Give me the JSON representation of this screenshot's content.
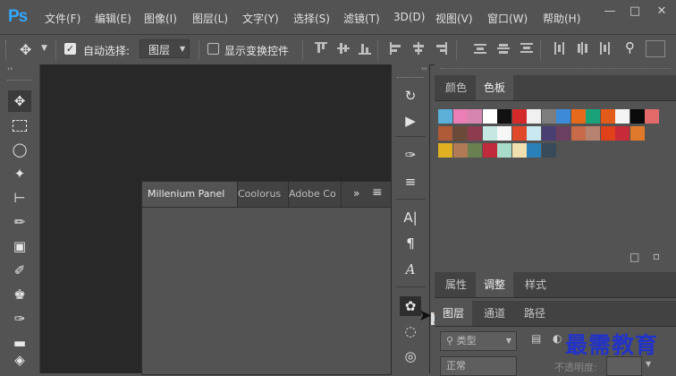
{
  "app": {
    "logo": "Ps"
  },
  "menu": [
    "文件(F)",
    "编辑(E)",
    "图像(I)",
    "图层(L)",
    "文字(Y)",
    "选择(S)",
    "滤镜(T)",
    "3D(D)",
    "视图(V)",
    "窗口(W)",
    "帮助(H)"
  ],
  "window_controls": [
    "minimize",
    "restore",
    "close"
  ],
  "options_bar": {
    "auto_select_label": "自动选择:",
    "auto_select_checked": true,
    "auto_select_target": "图层",
    "show_transform_label": "显示变换控件",
    "show_transform_checked": false
  },
  "floating_panel": {
    "tabs": [
      "Millenium Panel",
      "Coolorus",
      "Adobe Co"
    ],
    "active_tab": "Millenium Panel",
    "overflow": "»"
  },
  "right_panel": {
    "top_tabs": [
      "颜色",
      "色板"
    ],
    "top_active": "色板",
    "swatches": [
      [
        "#5ab0d8",
        "#e97fb4",
        "#d685b0",
        "#ffffff",
        "#111111",
        "#d42a2a",
        "#f0f0f0",
        "#7d7d7d",
        "#3d8bd8",
        "#e76a1a",
        "#1aa37a",
        "#e35b1a",
        "#f4f4f4",
        "#0a0a0a",
        "#e36a6a"
      ],
      [
        "#b05a37",
        "#6b4a3a",
        "#8e3b50",
        "#c7e8e2",
        "#f6f6f6",
        "#e04a2a",
        "#c9e9f0",
        "#4a3f73",
        "#6a3f5f",
        "#c76a4a",
        "#b88270",
        "#e0401a",
        "#c82a3a",
        "#e07a2a"
      ],
      [
        "#e0b020",
        "#b07a55",
        "#6a8050",
        "#c02a3a",
        "#a6dcc8",
        "#f0e0b0",
        "#2a80b8",
        "#364a5a"
      ]
    ],
    "mid_tabs": [
      "属性",
      "调整",
      "样式"
    ],
    "mid_active": "调整",
    "bottom_tabs": [
      "图层",
      "通道",
      "路径"
    ],
    "bottom_active": "图层",
    "layer_filter_label": "类型",
    "blend_mode": "正常",
    "opacity_label": "不透明度:"
  },
  "watermark": "最需教育"
}
